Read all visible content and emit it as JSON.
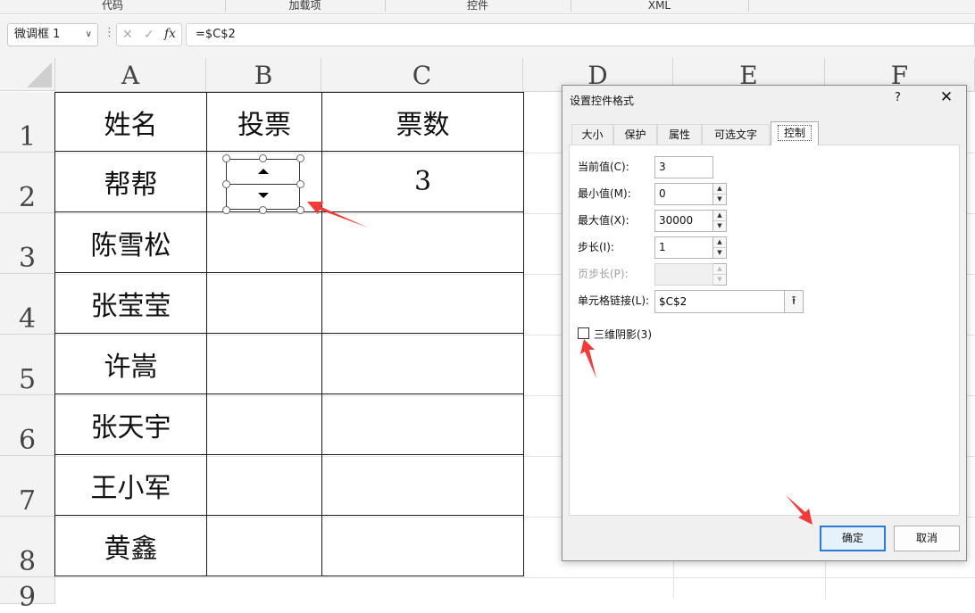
{
  "ribbon": {
    "groups": [
      "代码",
      "加载项",
      "控件",
      "XML"
    ]
  },
  "formula_bar": {
    "name_box": "微调框 1",
    "dots": "⋮",
    "cancel_glyph": "✕",
    "enter_glyph": "✓",
    "fx_label": "fx",
    "formula": "=$C$2"
  },
  "columns": [
    "A",
    "B",
    "C",
    "D",
    "E",
    "F"
  ],
  "rows": [
    "1",
    "2",
    "3",
    "4",
    "5",
    "6",
    "7",
    "8",
    "9"
  ],
  "table": {
    "header": [
      "姓名",
      "投票",
      "票数"
    ],
    "rows": [
      [
        "帮帮",
        "",
        "3"
      ],
      [
        "陈雪松",
        "",
        ""
      ],
      [
        "张莹莹",
        "",
        ""
      ],
      [
        "许嵩",
        "",
        ""
      ],
      [
        "张天宇",
        "",
        ""
      ],
      [
        "王小军",
        "",
        ""
      ],
      [
        "黄鑫",
        "",
        ""
      ]
    ]
  },
  "dialog": {
    "title": "设置控件格式",
    "help": "?",
    "close": "✕",
    "tabs": [
      "大小",
      "保护",
      "属性",
      "可选文字",
      "控制"
    ],
    "active_tab": "控制",
    "fields": {
      "current_label": "当前值(C):",
      "current_value": "3",
      "min_label": "最小值(M):",
      "min_value": "0",
      "max_label": "最大值(X):",
      "max_value": "30000",
      "step_label": "步长(I):",
      "step_value": "1",
      "page_label": "页步长(P):",
      "page_value": "",
      "link_label": "单元格链接(L):",
      "link_value": "$C$2"
    },
    "checkbox_label": "三维阴影(3)",
    "checkbox_checked": false,
    "ok_label": "确定",
    "cancel_label": "取消"
  },
  "colors": {
    "accent": "#2b79d7",
    "arrow": "#f23a3a",
    "header_bg": "#f3f3f3"
  }
}
